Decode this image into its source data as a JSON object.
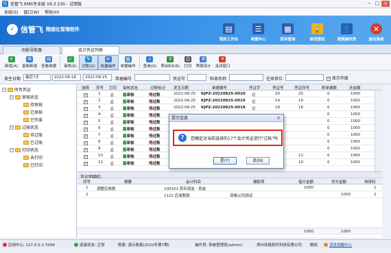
{
  "window": {
    "title": "信管飞 RMS专业版 V9.3.530 - 试用版"
  },
  "menu": [
    "系统(S)",
    "窗口(W)",
    "帮助(H)"
  ],
  "brand": {
    "name": "信管飞",
    "slogan": "精细化管理软件"
  },
  "nav_buttons": [
    {
      "label": "我的工作台",
      "icon": "workbench-icon",
      "color": "#2b5fa8"
    },
    {
      "label": "单据中心",
      "icon": "documents-icon",
      "color": "#2b5fa8"
    },
    {
      "label": "库存查询",
      "icon": "inventory-icon",
      "color": "#2b5fa8"
    },
    {
      "label": "修改密码",
      "icon": "lock-icon",
      "color": "#f2b020"
    },
    {
      "label": "更换操作员",
      "icon": "switch-user-icon",
      "color": "#2b5fa8"
    },
    {
      "label": "退出系统",
      "icon": "exit-icon",
      "color": "#d83a2a"
    }
  ],
  "tabs": [
    "功能导航器",
    "会计凭证列表"
  ],
  "toolbar": [
    {
      "label": "新增(A)",
      "icon": "add-icon",
      "color": "#2fa44a"
    },
    {
      "label": "复制新增",
      "icon": "copy-icon",
      "color": "#3a7fd0"
    },
    {
      "label": "查看单据",
      "icon": "view-icon",
      "color": "#3a7fd0"
    },
    {
      "label": "审核(K)",
      "icon": "audit-icon",
      "color": "#2fa44a"
    },
    {
      "label": "过账(G)",
      "icon": "post-icon",
      "color": "#2a8fc9"
    },
    {
      "label": "批量操作",
      "icon": "batch-icon",
      "color": "#3a7fd0"
    },
    {
      "label": "单据操作",
      "icon": "doc-op-icon",
      "color": "#3a7fd0"
    },
    {
      "label": "查询(Q)",
      "icon": "query-icon",
      "color": "#3a7fd0"
    },
    {
      "label": "导出EXCEL",
      "icon": "excel-icon",
      "color": "#2f8f3f"
    },
    {
      "label": "打印",
      "icon": "print-icon",
      "color": "#555555"
    },
    {
      "label": "界面设计",
      "icon": "design-icon",
      "color": "#3a7fd0"
    },
    {
      "label": "关闭窗口",
      "icon": "close-window-icon",
      "color": "#d83a2a"
    }
  ],
  "filter": {
    "date_label": "发生日期",
    "date_range_type": "最近7天",
    "date_from": "2022-08-18",
    "date_to": "2022-08-25",
    "docno_label": "单据编号",
    "voucher_label": "凭证号",
    "subject_label": "科目名称",
    "unit_label": "往来单位",
    "show_void_label": "显示作废"
  },
  "tree": [
    {
      "label": "所有凭证",
      "level": 0,
      "expander": "−"
    },
    {
      "label": "审核状态",
      "level": 1,
      "expander": "−"
    },
    {
      "label": "待审核",
      "level": 2
    },
    {
      "label": "已审核",
      "level": 2
    },
    {
      "label": "已作废",
      "level": 2
    },
    {
      "label": "过账状态",
      "level": 1,
      "expander": "−"
    },
    {
      "label": "待过账",
      "level": 2
    },
    {
      "label": "已过账",
      "level": 2
    },
    {
      "label": "打印状态",
      "level": 1,
      "expander": "−"
    },
    {
      "label": "未打印",
      "level": 2
    },
    {
      "label": "已打印",
      "level": 2
    }
  ],
  "grid": {
    "headers": [
      "选择",
      "序号",
      "打印",
      "审核状态",
      "过账标记",
      "发生日期",
      "单据编号",
      "凭证字",
      "凭证号",
      "凭证序号",
      "附单据数",
      "总金额"
    ],
    "rows": [
      {
        "no": "1",
        "status": "已审核",
        "post": "待过账",
        "date": "2022-08-25",
        "docno": "KJPZ-20220825-0020",
        "word": "记",
        "vno": "20",
        "seq": "20",
        "attach": "0",
        "amount": "1000"
      },
      {
        "no": "2",
        "status": "已审核",
        "post": "待过账",
        "date": "2022-08-25",
        "docno": "KJPZ-20220825-0019",
        "word": "记",
        "vno": "19",
        "seq": "19",
        "attach": "0",
        "amount": "1000"
      },
      {
        "no": "3",
        "status": "已审核",
        "post": "待过账",
        "date": "2022-08-25",
        "docno": "KJPZ-20220825-0018",
        "word": "记",
        "vno": "18",
        "seq": "18",
        "attach": "0",
        "amount": "1000"
      },
      {
        "no": "4",
        "status": "已审核",
        "post": "待过账",
        "date": "",
        "docno": "",
        "word": "",
        "vno": "",
        "seq": "",
        "attach": "0",
        "amount": "1000"
      },
      {
        "no": "5",
        "status": "已审核",
        "post": "待过账",
        "date": "",
        "docno": "",
        "word": "",
        "vno": "",
        "seq": "",
        "attach": "0",
        "amount": "1000"
      },
      {
        "no": "6",
        "status": "已审核",
        "post": "待过账",
        "date": "",
        "docno": "",
        "word": "",
        "vno": "",
        "seq": "",
        "attach": "0",
        "amount": "1000"
      },
      {
        "no": "7",
        "status": "已审核",
        "post": "待过账",
        "date": "",
        "docno": "",
        "word": "",
        "vno": "",
        "seq": "",
        "attach": "0",
        "amount": "1000"
      },
      {
        "no": "8",
        "status": "已审核",
        "post": "待过账",
        "date": "",
        "docno": "",
        "word": "",
        "vno": "",
        "seq": "",
        "attach": "0",
        "amount": "1000"
      },
      {
        "no": "9",
        "status": "已审核",
        "post": "待过账",
        "date": "",
        "docno": "",
        "word": "",
        "vno": "",
        "seq": "",
        "attach": "0",
        "amount": "1000"
      },
      {
        "no": "10",
        "status": "已审核",
        "post": "待过账",
        "date": "2022-08-25",
        "docno": "KJPZ-20220825-0011",
        "word": "记",
        "vno": "11",
        "seq": "11",
        "attach": "0",
        "amount": "1000"
      },
      {
        "no": "11",
        "status": "已审核",
        "post": "待过账",
        "date": "2022-08-25",
        "docno": "KJPZ-20220825-0010",
        "word": "记",
        "vno": "10",
        "seq": "10",
        "attach": "0",
        "amount": "1000"
      }
    ]
  },
  "detail": {
    "title": "凭证明细栏:",
    "headers": [
      "序号",
      "摘要",
      "会计科目",
      "辅助项",
      "借方金额",
      "贷方金额",
      "排序码"
    ],
    "rows": [
      {
        "no": "1",
        "summary": "调整应收款",
        "subject": "100101 库存现金 - 现金",
        "aux": "",
        "debit": "1000",
        "credit": "",
        "sort": "1"
      },
      {
        "no": "2",
        "summary": "",
        "subject": "1122 应收账款",
        "aux": "亚格公司测试",
        "debit": "",
        "credit": "1000",
        "sort": "2"
      }
    ],
    "totals": {
      "debit": "1000",
      "credit": "1000"
    }
  },
  "dialog": {
    "title": "提示信息",
    "message": "您确定对当前选择的17个会计凭证进行\"过账\"吗",
    "yes_label": "是(Y)",
    "no_label": "否(N)"
  },
  "statusbar": {
    "app_center": "应用中心: 127.0.0.1:7099",
    "connection": "连接状态: 正常",
    "account": "账套: 演示账套(2022年第7期)",
    "operator": "操作员: 系统管理员(admin)",
    "company": "郑州亚格软件科技有限公司",
    "edition": "数权",
    "push_center": "消息提醒中心"
  }
}
